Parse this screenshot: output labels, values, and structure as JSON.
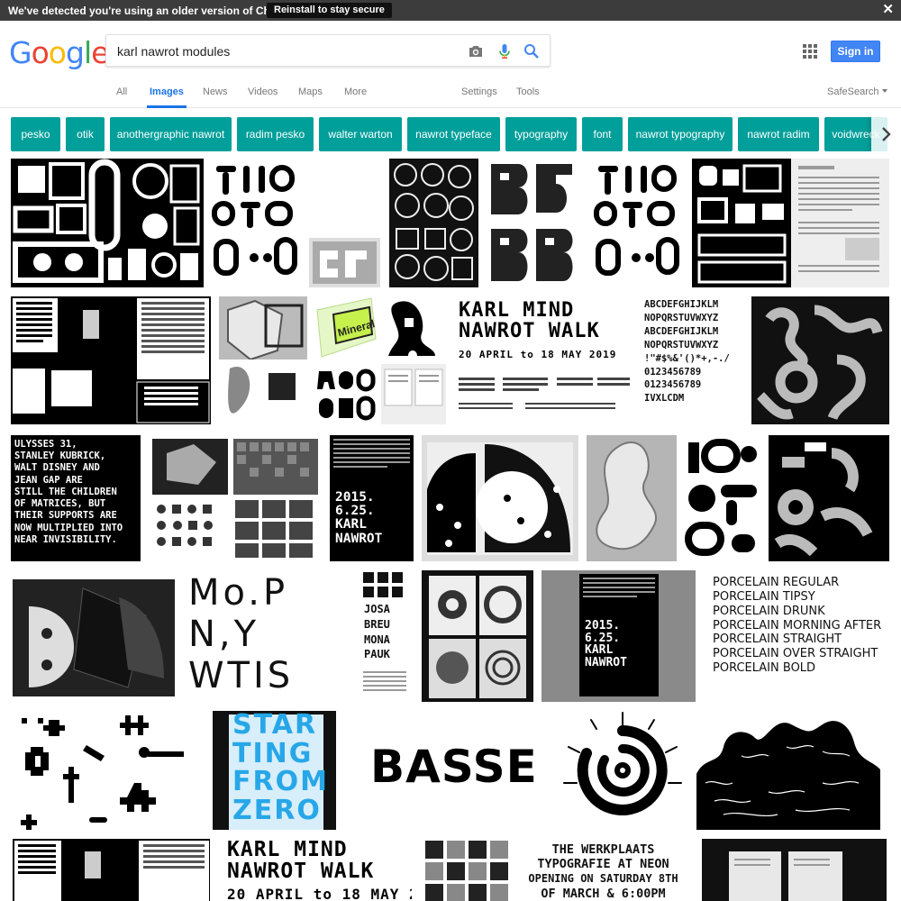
{
  "notice": {
    "message": "We've detected you're using an older version of Chrome.",
    "button_label": "Reinstall to stay secure",
    "close_glyph": "✕"
  },
  "logo": {
    "letters": [
      "G",
      "o",
      "o",
      "g",
      "l",
      "e"
    ]
  },
  "search": {
    "query": "karl nawrot modules"
  },
  "header": {
    "signin_label": "Sign in",
    "safesearch_label": "SafeSearch"
  },
  "tabs": [
    {
      "label": "All",
      "active": false
    },
    {
      "label": "Images",
      "active": true
    },
    {
      "label": "News",
      "active": false
    },
    {
      "label": "Videos",
      "active": false
    },
    {
      "label": "Maps",
      "active": false
    },
    {
      "label": "More",
      "active": false
    }
  ],
  "tools": [
    {
      "label": "Settings"
    },
    {
      "label": "Tools"
    }
  ],
  "chips": [
    {
      "label": "pesko"
    },
    {
      "label": "otik"
    },
    {
      "label": "anothergraphic nawrot"
    },
    {
      "label": "radim pesko"
    },
    {
      "label": "walter warton"
    },
    {
      "label": "nawrot typeface"
    },
    {
      "label": "typography"
    },
    {
      "label": "font"
    },
    {
      "label": "nawrot typography"
    },
    {
      "label": "nawrot radim"
    },
    {
      "label": "voidwreck"
    }
  ],
  "colors": {
    "chip": "#009f9a",
    "accent": "#1a73e8",
    "signin": "#4285f4",
    "notice": "#3c3c3c"
  },
  "image_texts": {
    "poster_karl": [
      "KARL MIND",
      "NAWROT WALK",
      "20 APRIL to 18 MAY 2019"
    ],
    "ulysses": [
      "ULYSSES 31,",
      "STANLEY KUBRICK,",
      "WALT DISNEY AND",
      "JEAN GAP ARE",
      "STILL THE CHILDREN",
      "OF MATRICES, BUT",
      "THEIR SUPPORTS ARE",
      "NOW MULTIPLIED INTO",
      "NEAR INVISIBILITY."
    ],
    "date_2015": [
      "2015.",
      "6.25.",
      "KARL",
      "NAWROT"
    ],
    "porcelain": [
      "PORCELAIN REGULAR",
      "PORCELAIN TIPSY",
      "PORCELAIN DRUNK",
      "PORCELAIN MORNING AFTER",
      "PORCELAIN STRAIGHT",
      "PORCELAIN OVER STRAIGHT",
      "PORCELAIN BOLD"
    ],
    "basse": "BASSE",
    "werkplaats": [
      "THE WERKPLAATS",
      "TYPOGRAFIE AT NEON",
      "OPENING ON SATURDAY 8TH",
      "OF MARCH & 6:00PM"
    ],
    "start": [
      "STAR",
      "TING",
      "FROM",
      "ZERO"
    ],
    "mopn": [
      "Mo.P",
      "N,Y",
      "WTIS"
    ],
    "josa": [
      "JOSA",
      "BREU",
      "MONA",
      "PAUK"
    ],
    "alphabet": [
      "ABCDEFGHIJKLM",
      "NOPQRSTUVWXYZ",
      "ABCDEFGHIJKLM",
      "NOPQRSTUVWXYZ",
      "!\"#$%&'()*+,-./",
      "0123456789",
      "0123456789",
      "IVXLCDM"
    ]
  }
}
